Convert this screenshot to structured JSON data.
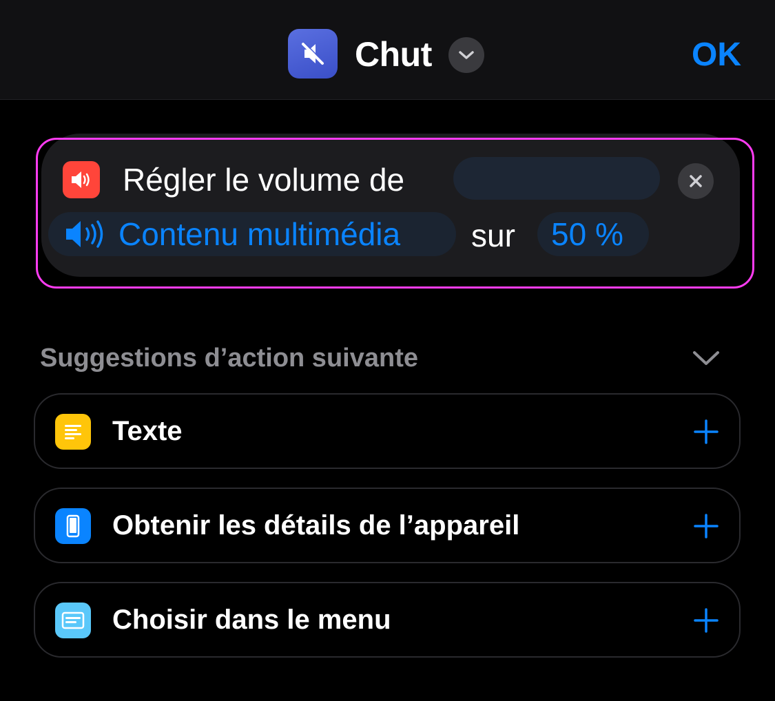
{
  "header": {
    "title": "Chut",
    "app_icon": "speaker-muted-icon",
    "ok_label": "OK",
    "accent_color": "#0a84ff"
  },
  "action": {
    "title": "Régler le volume de",
    "media_label": "Contenu multimédia",
    "connector": "sur",
    "volume_value": "50 %",
    "icon": "speaker-icon",
    "icon_color": "#ff453a",
    "highlight_color": "#ff3cf2"
  },
  "suggestions": {
    "header": "Suggestions d’action suivante",
    "items": [
      {
        "label": "Texte",
        "icon": "text-icon",
        "color": "#ffc50a"
      },
      {
        "label": "Obtenir les détails de l’appareil",
        "icon": "phone-icon",
        "color": "#0a84ff"
      },
      {
        "label": "Choisir dans le menu",
        "icon": "menu-icon",
        "color": "#5ac8fa"
      }
    ]
  }
}
